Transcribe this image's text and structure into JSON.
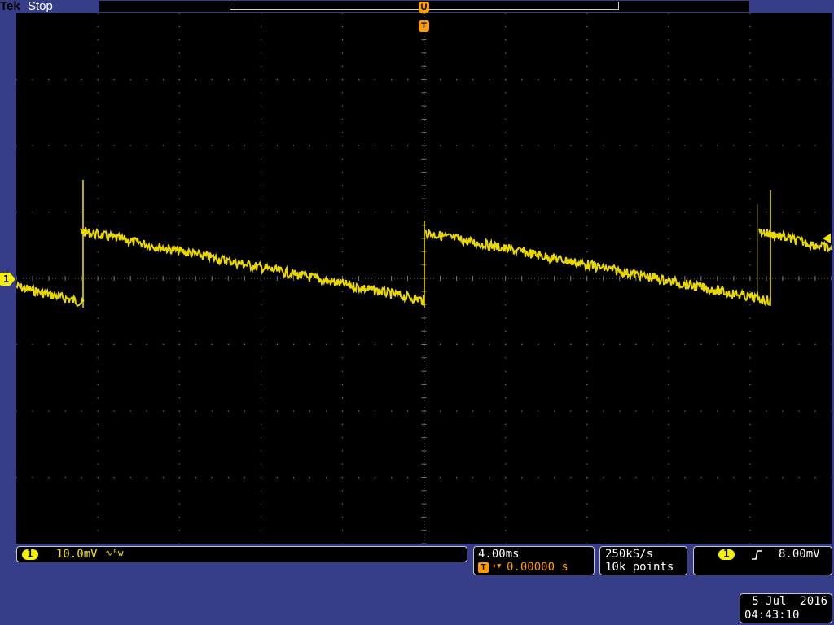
{
  "header": {
    "brand": "Tek",
    "status": "Stop"
  },
  "markers": {
    "channel_ground": "1",
    "trigger_position": "T",
    "record_position": "U"
  },
  "channel": {
    "number": "1",
    "scale": "10.0mV",
    "coupling_icon": "∿ᴮw"
  },
  "timebase": {
    "scale": "4.00ms",
    "trigger_icon": "T",
    "delay": "0.00000 s"
  },
  "acquisition": {
    "sample_rate": "250kS/s",
    "record_length": "10k points"
  },
  "trigger": {
    "source": "1",
    "slope_icon": "rising-edge-icon",
    "level": "8.00mV"
  },
  "clock": {
    "date": "5 Jul  2016",
    "time": "04:43:10"
  },
  "colors": {
    "background": "#363e89",
    "screen": "#000000",
    "trace": "#f5e400",
    "trigger_marker": "#ff9d00",
    "grid": "#7a7a7a"
  }
}
